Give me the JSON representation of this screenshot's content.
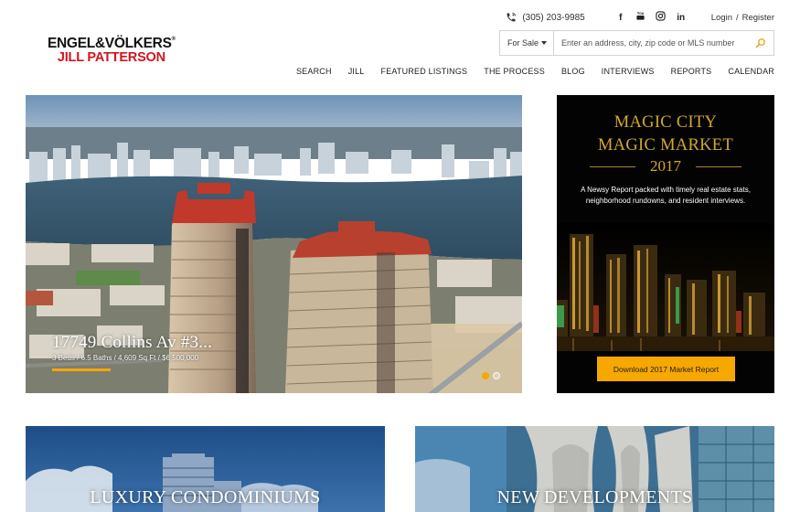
{
  "topbar": {
    "phone": "(305) 203-9985",
    "social": [
      {
        "icon": "facebook-icon",
        "glyph": "f"
      },
      {
        "icon": "youtube-icon",
        "glyph": "▶"
      },
      {
        "icon": "instagram-icon",
        "glyph": "◎"
      },
      {
        "icon": "linkedin-icon",
        "glyph": "in"
      }
    ],
    "login": "Login",
    "separator": "/",
    "register": "Register"
  },
  "logo": {
    "line1": "ENGEL&VÖLKERS",
    "registered": "®",
    "line2": "JILL PATTERSON"
  },
  "search": {
    "filter_value": "For Sale",
    "placeholder": "Enter an address, city, zip code or MLS number"
  },
  "nav": [
    "SEARCH",
    "JILL",
    "FEATURED LISTINGS",
    "THE PROCESS",
    "BLOG",
    "INTERVIEWS",
    "REPORTS",
    "CALENDAR"
  ],
  "hero": {
    "title": "17749 Collins Av #3...",
    "details": "3 Beds / 6.5 Baths / 4,609 Sq Ft / $6,500,000",
    "active_slide": 1,
    "slide_count": 2
  },
  "magic": {
    "title_line1": "MAGIC CITY",
    "title_line2": "MAGIC MARKET",
    "year": "2017",
    "description": "A Newsy Report packed with timely real estate stats, neighborhood rundowns, and resident interviews.",
    "cta": "Download 2017 Market Report"
  },
  "tiles": {
    "left_title": "LUXURY CONDOMINIUMS",
    "right_title": "NEW DEVELOPMENTS"
  },
  "colors": {
    "accent": "#f6a800",
    "brand_red": "#d0161f",
    "gold": "#d4a92c"
  }
}
